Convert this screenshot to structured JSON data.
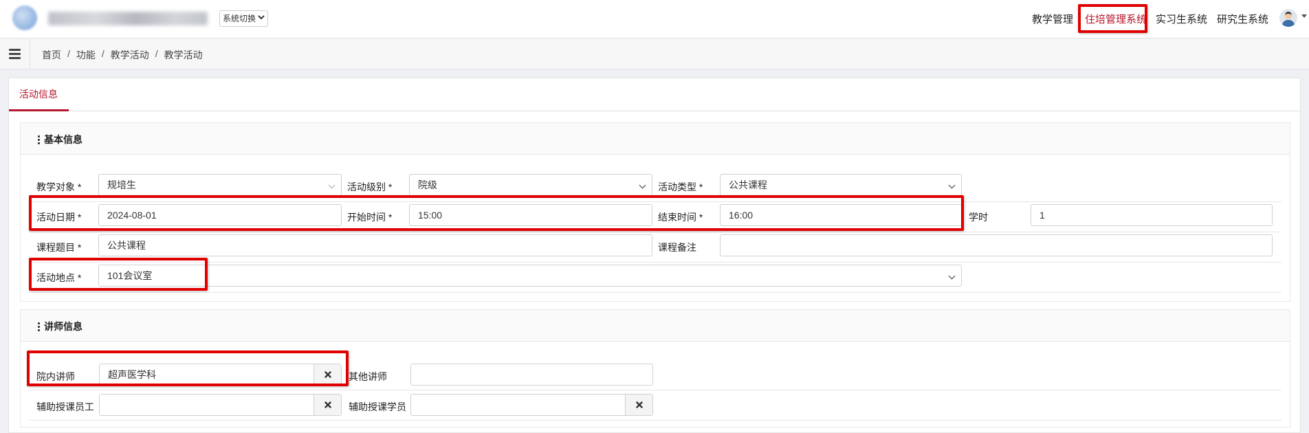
{
  "header": {
    "system_switch_label": "系统切换",
    "nav": [
      {
        "label": "教学管理",
        "active": false
      },
      {
        "label": "住培管理系统",
        "active": true
      },
      {
        "label": "实习生系统",
        "active": false
      },
      {
        "label": "研究生系统",
        "active": false
      }
    ]
  },
  "breadcrumb": [
    "首页",
    "功能",
    "教学活动",
    "教学活动"
  ],
  "tab": {
    "label": "活动信息"
  },
  "basic_info": {
    "title": "基本信息",
    "teaching_target": {
      "label": "教学对象 *",
      "value": "规培生"
    },
    "activity_level": {
      "label": "活动级别 *",
      "value": "院级"
    },
    "activity_type": {
      "label": "活动类型 *",
      "value": "公共课程"
    },
    "activity_date": {
      "label": "活动日期 *",
      "value": "2024-08-01"
    },
    "start_time": {
      "label": "开始时间 *",
      "value": "15:00"
    },
    "end_time": {
      "label": "结束时间 *",
      "value": "16:00"
    },
    "class_hours": {
      "label": "学时",
      "value": "1"
    },
    "course_topic": {
      "label": "课程题目 *",
      "value": "公共课程"
    },
    "course_note": {
      "label": "课程备注",
      "value": ""
    },
    "activity_location": {
      "label": "活动地点 *",
      "value": "101会议室"
    }
  },
  "lecturer_info": {
    "title": "讲师信息",
    "internal_lecturer": {
      "label": "院内讲师",
      "value": "超声医学科"
    },
    "other_lecturer": {
      "label": "其他讲师",
      "value": ""
    },
    "assistant_staff": {
      "label": "辅助授课员工",
      "value": ""
    },
    "assistant_student": {
      "label": "辅助授课学员",
      "value": ""
    }
  },
  "colors": {
    "accent": "#b5152b",
    "highlight": "#e00000"
  }
}
